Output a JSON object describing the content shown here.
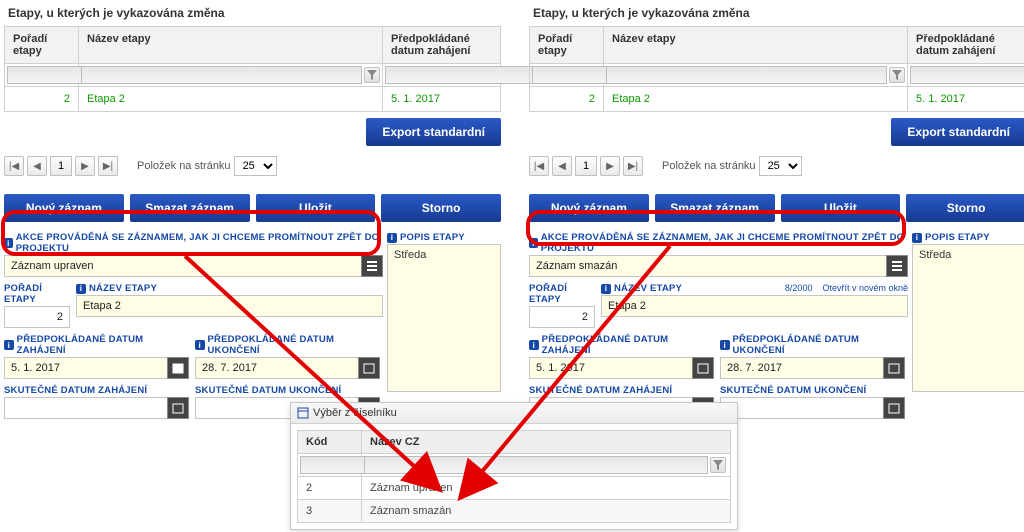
{
  "sectionTitle": "Etapy, u kterých je vykazována změna",
  "grid": {
    "headers": {
      "a": "Pořadí etapy",
      "b": "Název etapy",
      "c": "Předpokládané datum zahájení"
    },
    "row": {
      "a": "2",
      "b": "Etapa 2",
      "c": "5. 1. 2017"
    }
  },
  "exportBtn": "Export standardní",
  "pager": {
    "first": "|◀",
    "prev": "◀",
    "next": "▶",
    "last": "▶|",
    "page": "1",
    "label": "Položek na stránku",
    "perPage": "25"
  },
  "actions": {
    "new": "Nový záznam",
    "delete": "Smazat záznam",
    "save": "Uložit",
    "cancel": "Storno"
  },
  "formLabels": {
    "akce": "AKCE PROVÁDĚNÁ SE ZÁZNAMEM, JAK JI CHCEME PROMÍTNOUT ZPĚT DO PROJEKTU",
    "popis": "POPIS ETAPY",
    "poradi": "POŘADÍ ETAPY",
    "nazev": "NÁZEV ETAPY",
    "countMeta": "8/2000",
    "openMeta": "Otevřít v novém okně",
    "predZah": "PŘEDPOKLÁDANÉ DATUM ZAHÁJENÍ",
    "predUkon": "PŘEDPOKLÁDANÉ DATUM UKONČENÍ",
    "skutZah": "SKUTEČNÉ DATUM ZAHÁJENÍ",
    "skutUkon": "SKUTEČNÉ DATUM UKONČENÍ"
  },
  "left": {
    "akceValue": "Záznam upraven",
    "popisValue": "Středa",
    "poradi": "2",
    "nazev": "Etapa 2",
    "predZah": "5. 1. 2017",
    "predUkon": "28. 7. 2017",
    "skutZah": "",
    "skutUkon": ""
  },
  "right": {
    "akceValue": "Záznam smazán",
    "popisValue": "Středa",
    "poradi": "2",
    "nazev": "Etapa 2",
    "predZah": "5. 1. 2017",
    "predUkon": "28. 7. 2017",
    "skutZah": "",
    "skutUkon": ""
  },
  "lookup": {
    "title": "Výběr z číselníku",
    "headers": {
      "a": "Kód",
      "b": "Název CZ"
    },
    "rows": [
      {
        "a": "2",
        "b": "Záznam upraven"
      },
      {
        "a": "3",
        "b": "Záznam smazán"
      }
    ]
  }
}
